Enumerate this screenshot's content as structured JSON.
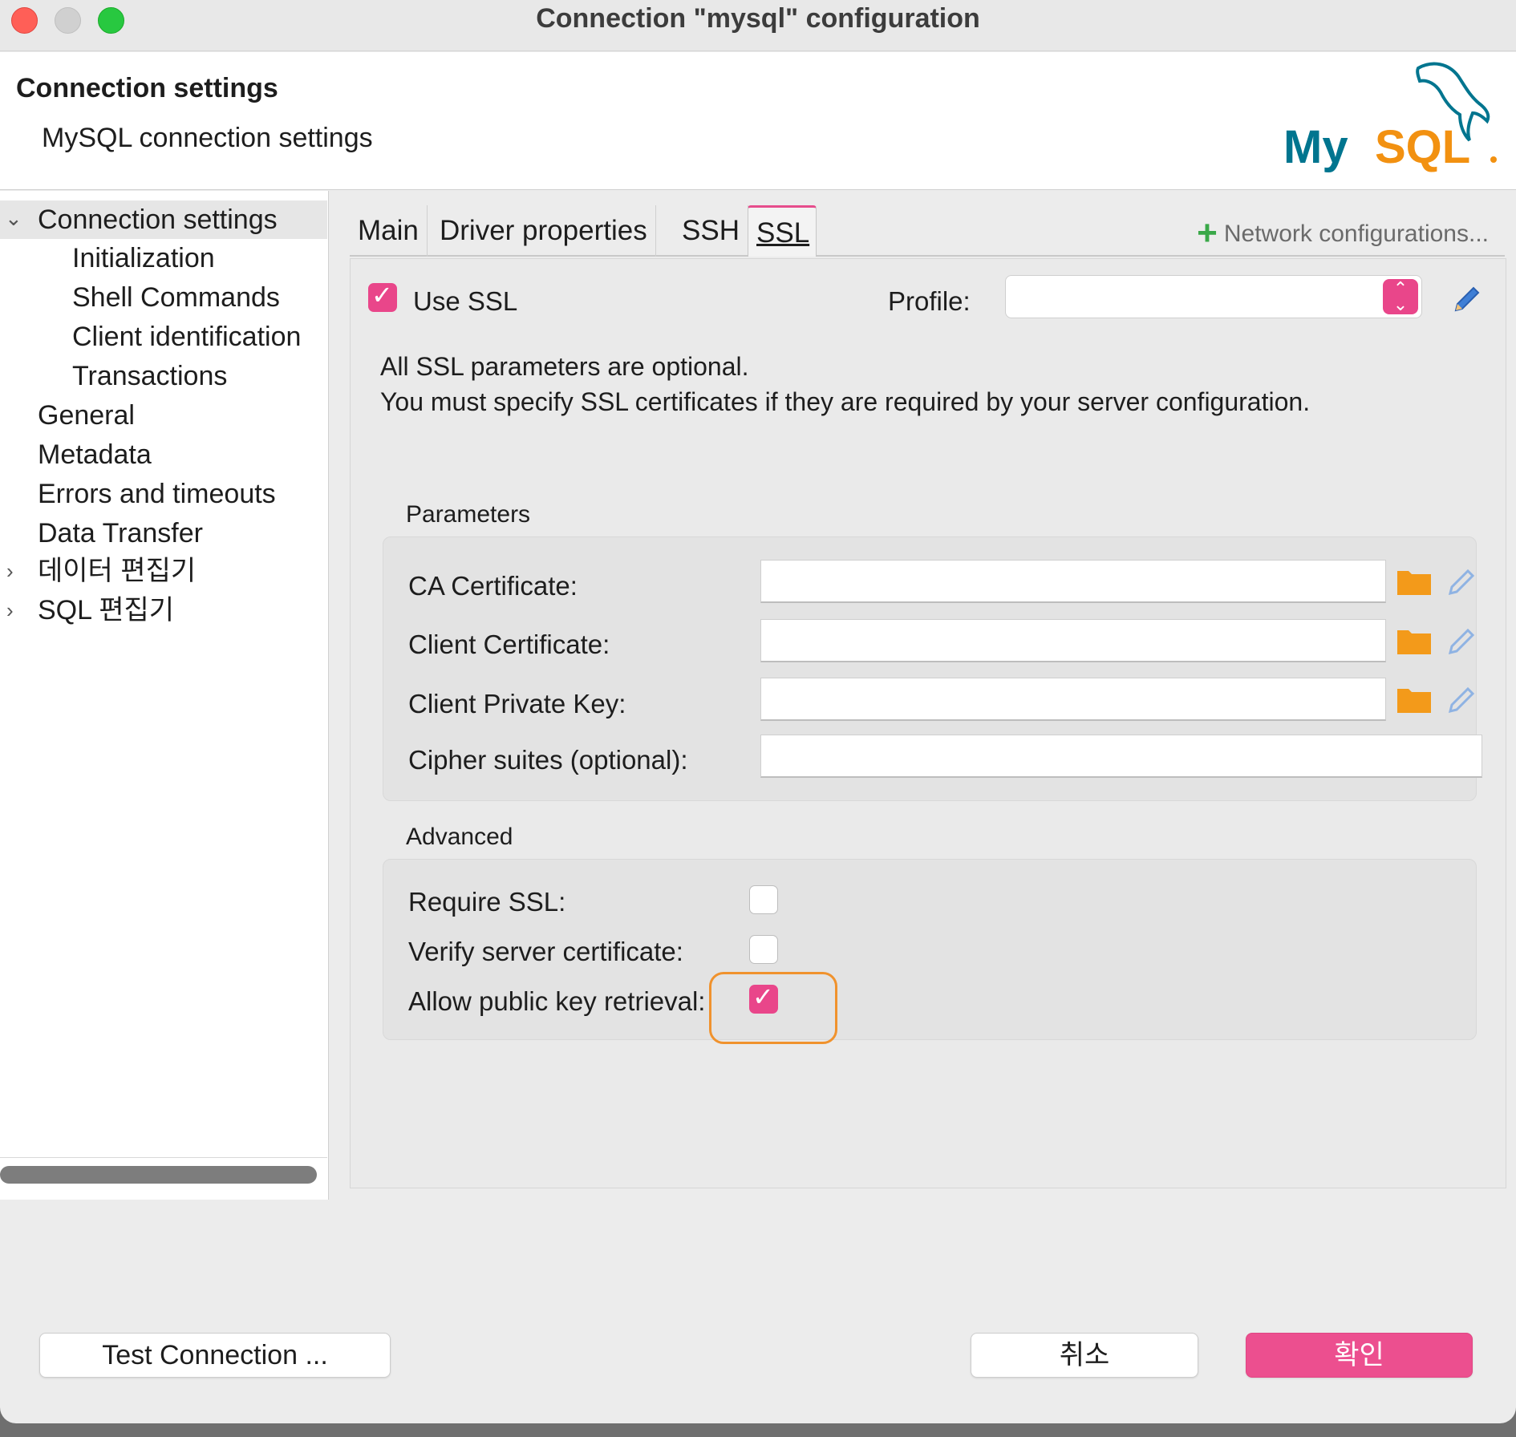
{
  "window": {
    "title": "Connection \"mysql\" configuration"
  },
  "header": {
    "title": "Connection settings",
    "subtitle": "MySQL connection settings",
    "logo_text": "MySQL"
  },
  "sidebar": {
    "items": [
      {
        "label": "Connection settings",
        "expanded": true,
        "selected": true
      },
      {
        "label": "Initialization"
      },
      {
        "label": "Shell Commands"
      },
      {
        "label": "Client identification"
      },
      {
        "label": "Transactions"
      },
      {
        "label": "General"
      },
      {
        "label": "Metadata"
      },
      {
        "label": "Errors and timeouts"
      },
      {
        "label": "Data Transfer"
      },
      {
        "label": "데이터 편집기",
        "collapsed": true
      },
      {
        "label": "SQL 편집기",
        "collapsed": true
      }
    ]
  },
  "tabs": {
    "items": [
      "Main",
      "Driver properties",
      "SSH",
      "SSL"
    ],
    "active": "SSL",
    "network_config": "Network configurations..."
  },
  "ssl": {
    "use_ssl_label": "Use SSL",
    "use_ssl_checked": true,
    "profile_label": "Profile:",
    "profile_value": "",
    "info_line1": "All SSL parameters are optional.",
    "info_line2": "You must specify SSL certificates if they are required by your server configuration.",
    "parameters_title": "Parameters",
    "ca_cert_label": "CA Certificate:",
    "ca_cert_value": "",
    "client_cert_label": "Client Certificate:",
    "client_cert_value": "",
    "client_key_label": "Client Private Key:",
    "client_key_value": "",
    "cipher_label": "Cipher suites (optional):",
    "cipher_value": "",
    "advanced_title": "Advanced",
    "require_ssl_label": "Require SSL:",
    "require_ssl_checked": false,
    "verify_cert_label": "Verify server certificate:",
    "verify_cert_checked": false,
    "allow_pubkey_label": "Allow public key retrieval:",
    "allow_pubkey_checked": true
  },
  "footer": {
    "test_connection": "Test Connection ...",
    "cancel": "취소",
    "ok": "확인"
  },
  "colors": {
    "accent": "#ec4f8f",
    "folder": "#f39a1a",
    "highlight": "#f0922d",
    "mysql_blue": "#00758f",
    "mysql_orange": "#f29111"
  }
}
